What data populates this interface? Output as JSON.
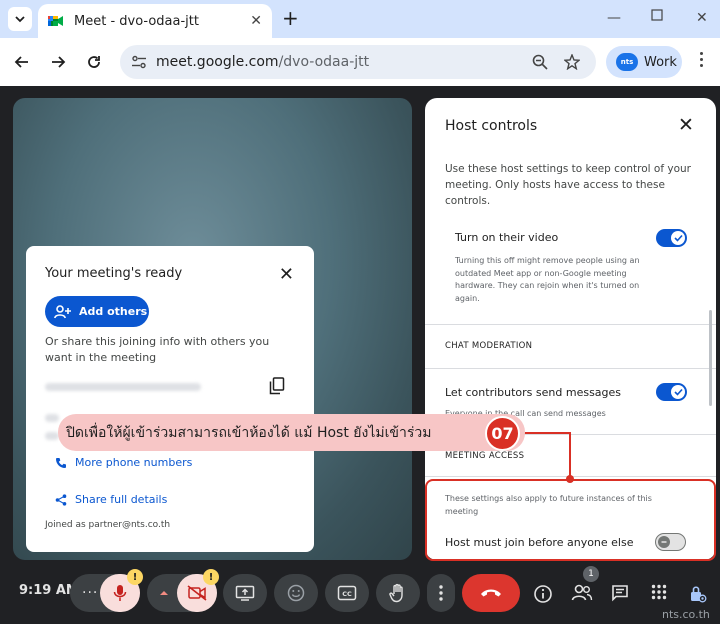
{
  "browser": {
    "tab_title": "Meet - dvo-odaa-jtt",
    "url_host": "meet.google.com",
    "url_path": "/dvo-odaa-jtt",
    "profile_logo": "nts",
    "profile_label": "Work"
  },
  "ready_card": {
    "title": "Your meeting's ready",
    "add_others_label": "Add others",
    "share_info": "Or share this joining info with others you want in the meeting",
    "phone_link": "More phone numbers",
    "share_link": "Share full details",
    "joined_as": "Joined as partner@nts.co.th"
  },
  "host_controls": {
    "title": "Host controls",
    "description": "Use these host settings to keep control of your meeting. Only hosts have access to these controls.",
    "video_option": {
      "label": "Turn on their video",
      "description": "Turning this off might remove people using an outdated Meet app or non-Google meeting hardware. They can rejoin when it's turned on again.",
      "enabled": true
    },
    "chat_section": "CHAT MODERATION",
    "chat_option": {
      "label": "Let contributors send messages",
      "description": "Everyone in the call can send messages",
      "enabled": true
    },
    "access_section": "MEETING ACCESS",
    "access_note": "These settings also apply to future instances of this meeting",
    "host_join_option": {
      "label": "Host must join before anyone else",
      "enabled": false
    }
  },
  "annotation": {
    "text": "ปิดเพื่อให้ผู้เข้าร่วมสามารถเข้าห้องได้ แม้ Host ยังไม่เข้าร่วม",
    "step": "07",
    "color": "#d93025"
  },
  "bottom_bar": {
    "time": "9:19 AM",
    "people_count": "1",
    "watermark": "nts.co.th"
  }
}
